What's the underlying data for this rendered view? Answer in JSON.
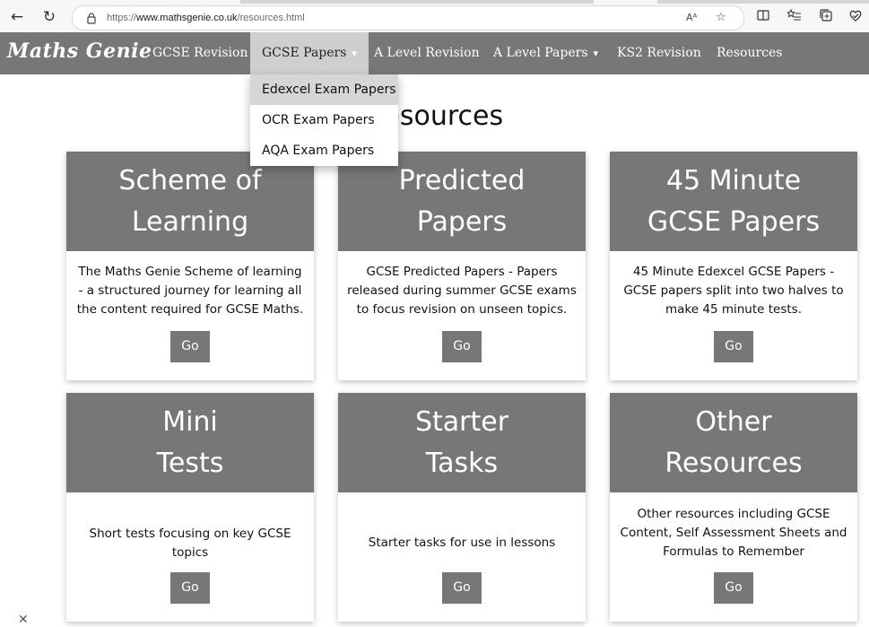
{
  "browser": {
    "url_prefix": "https://",
    "url_host": "www.mathsgenie.co.uk",
    "url_path": "/resources.html",
    "back_icon": "back-arrow-icon",
    "refresh_icon": "refresh-icon",
    "read_aloud_label": "Aᴬ"
  },
  "site": {
    "logo": "Maths Genie",
    "nav": [
      {
        "label": "GCSE Revision"
      },
      {
        "label": "GCSE Papers",
        "caret": "▾"
      },
      {
        "label": "A Level Revision"
      },
      {
        "label": "A Level Papers",
        "caret": "▾"
      },
      {
        "label": "KS2 Revision"
      },
      {
        "label": "Resources"
      }
    ],
    "dropdown": [
      {
        "label": "Edexcel Exam Papers"
      },
      {
        "label": "OCR Exam Papers"
      },
      {
        "label": "AQA Exam Papers"
      }
    ]
  },
  "page": {
    "title": "Resources",
    "cards": [
      {
        "line1": "Scheme of",
        "line2": "Learning",
        "desc": "The Maths Genie Scheme of learning - a structured journey for learning all the content required for GCSE Maths.",
        "button": "Go"
      },
      {
        "line1": "Predicted",
        "line2": "Papers",
        "desc": "GCSE Predicted Papers - Papers released during summer GCSE exams to focus revision on unseen topics.",
        "button": "Go"
      },
      {
        "line1": "45 Minute",
        "line2": "GCSE Papers",
        "desc": "45 Minute Edexcel GCSE Papers - GCSE papers split into two halves to make 45 minute tests.",
        "button": "Go"
      },
      {
        "line1": "Mini",
        "line2": "Tests",
        "desc": "Short tests focusing on key GCSE topics",
        "button": "Go"
      },
      {
        "line1": "Starter",
        "line2": "Tasks",
        "desc": "Starter tasks for use in lessons",
        "button": "Go"
      },
      {
        "line1": "Other",
        "line2": "Resources",
        "desc": "Other resources including GCSE Content, Self Assessment Sheets and Formulas to Remember",
        "button": "Go"
      }
    ]
  },
  "colors": {
    "nav_bg": "#777777",
    "active_bg": "#cfcfcf",
    "highlight_bg": "#d6d6d6"
  }
}
